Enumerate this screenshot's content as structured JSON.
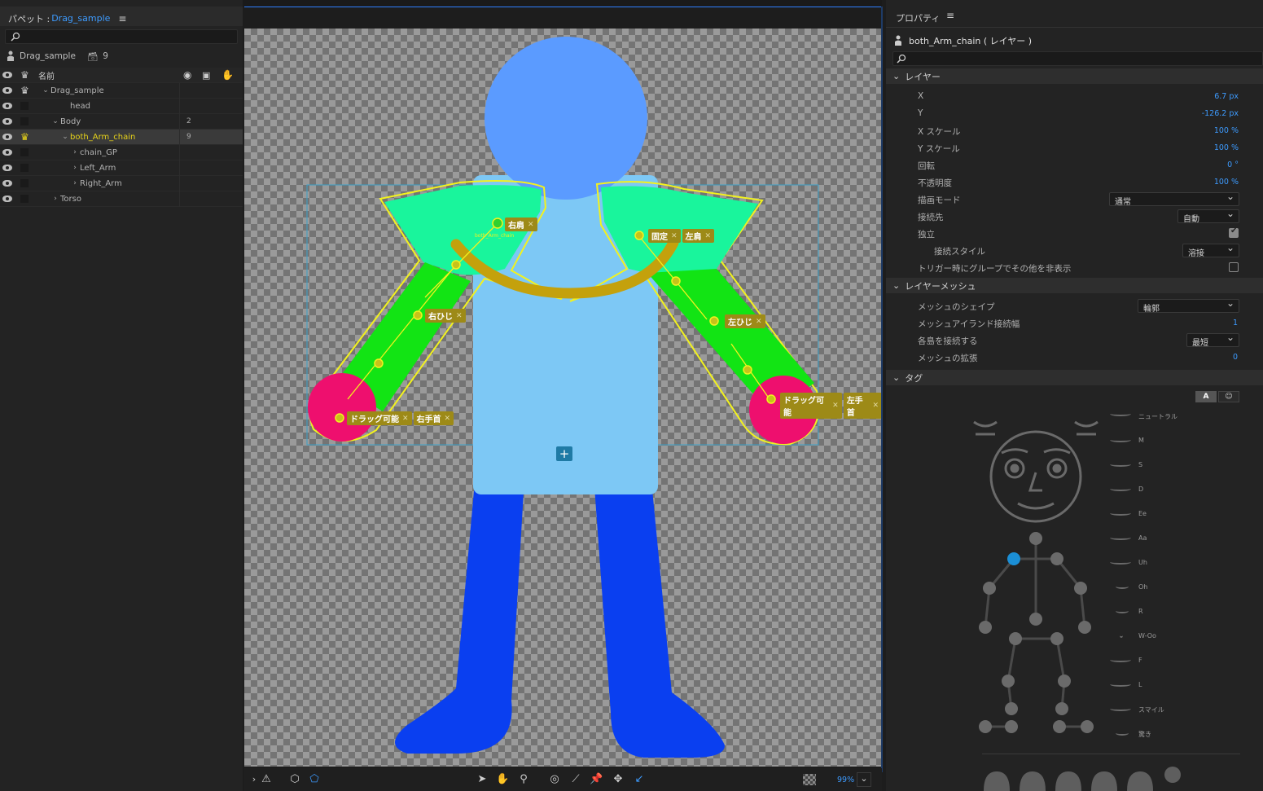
{
  "puppet_panel": {
    "title_prefix": "パペット : ",
    "title_name": "Drag_sample",
    "puppet_name": "Drag_sample",
    "puppet_count": "9",
    "col_name": "名前",
    "layers": [
      {
        "name": "Drag_sample",
        "count": "",
        "indent": 1,
        "expanded": true,
        "selected": false,
        "crown": true
      },
      {
        "name": "head",
        "count": "",
        "indent": 3,
        "expanded": null,
        "selected": false,
        "crown": false
      },
      {
        "name": "Body",
        "count": "2",
        "indent": 2,
        "expanded": true,
        "selected": false,
        "crown": false
      },
      {
        "name": "both_Arm_chain",
        "count": "9",
        "indent": 3,
        "expanded": true,
        "selected": true,
        "crown": true
      },
      {
        "name": "chain_GP",
        "count": "",
        "indent": 4,
        "expanded": false,
        "selected": false,
        "crown": false
      },
      {
        "name": "Left_Arm",
        "count": "",
        "indent": 4,
        "expanded": false,
        "selected": false,
        "crown": false
      },
      {
        "name": "Right_Arm",
        "count": "",
        "indent": 4,
        "expanded": false,
        "selected": false,
        "crown": false
      },
      {
        "name": "Torso",
        "count": "",
        "indent": 2,
        "expanded": false,
        "selected": false,
        "crown": false
      }
    ]
  },
  "canvas": {
    "handle_tags": {
      "right_shoulder": [
        "右肩"
      ],
      "left_shoulder": [
        "固定",
        "左肩"
      ],
      "right_elbow": [
        "右ひじ"
      ],
      "left_elbow": [
        "左ひじ"
      ],
      "right_wrist": [
        "ドラッグ可能",
        "右手首"
      ],
      "left_wrist": [
        "ドラッグ可能",
        "左手首"
      ]
    },
    "origin_label": "both_Arm_chain",
    "zoom": "99%"
  },
  "properties": {
    "title": "プロパティ",
    "layer_name": "both_Arm_chain ( レイヤー )",
    "sections": {
      "layer": "レイヤー",
      "mesh": "レイヤーメッシュ",
      "tags": "タグ"
    },
    "layer_props": [
      {
        "label": "X",
        "value": "6.7 px"
      },
      {
        "label": "Y",
        "value": "-126.2 px"
      },
      {
        "label": "X スケール",
        "value": "100 %"
      },
      {
        "label": "Y スケール",
        "value": "100 %"
      },
      {
        "label": "回転",
        "value": "0 °"
      },
      {
        "label": "不透明度",
        "value": "100 %"
      }
    ],
    "blend_mode": {
      "label": "描画モード",
      "value": "通常"
    },
    "attach_to": {
      "label": "接続先",
      "value": "自動"
    },
    "independent": {
      "label": "独立",
      "checked": true
    },
    "attach_style": {
      "label": "接続スタイル",
      "value": "溶接"
    },
    "hide_others": {
      "label": "トリガー時にグループでその他を非表示",
      "checked": false
    },
    "mesh_shape": {
      "label": "メッシュのシェイプ",
      "value": "輪郭"
    },
    "mesh_island": {
      "label": "メッシュアイランド接続幅",
      "value": "1"
    },
    "connect_islands": {
      "label": "各島を接続する",
      "value": "最短"
    },
    "mesh_expand": {
      "label": "メッシュの拡張",
      "value": "0"
    },
    "tag_toggle": {
      "a": "A"
    },
    "mouth_labels": [
      "ニュートラル",
      "M",
      "S",
      "D",
      "Ee",
      "Aa",
      "Uh",
      "Oh",
      "R",
      "W-Oo",
      "F",
      "L",
      "スマイル",
      "驚き"
    ]
  },
  "colors": {
    "head": "#5b9bff",
    "torso": "#7dc8f5",
    "legs": "#0a3ff0",
    "shoulder": "#19f59c",
    "arm": "#12e414",
    "hand": "#ee0f6e",
    "outline": "#f2f21e",
    "chain": "#c4a10c",
    "accent": "#3d9bff"
  }
}
